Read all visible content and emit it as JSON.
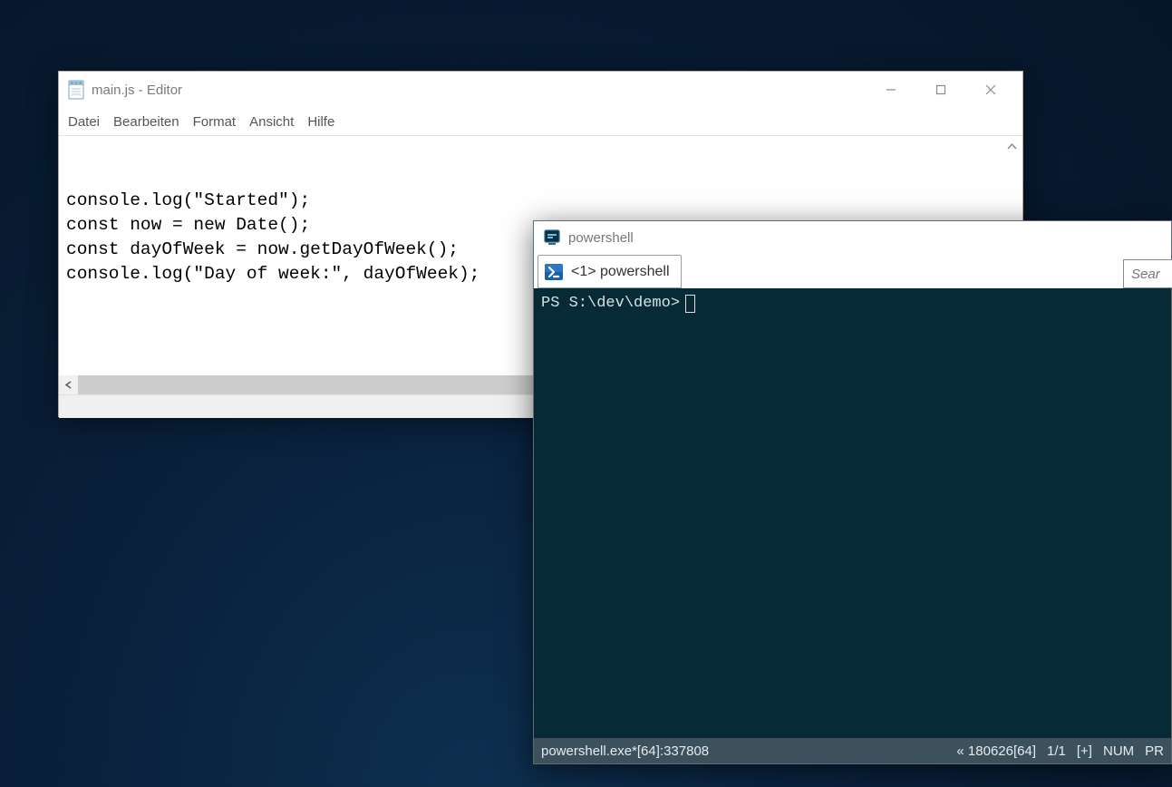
{
  "editor": {
    "title": "main.js - Editor",
    "menus": {
      "file": "Datei",
      "edit": "Bearbeiten",
      "format": "Format",
      "view": "Ansicht",
      "help": "Hilfe"
    },
    "content": "console.log(\"Started\");\nconst now = new Date();\nconst dayOfWeek = now.getDayOfWeek();\nconsole.log(\"Day of week:\", dayOfWeek);"
  },
  "powershell": {
    "title": "powershell",
    "tab_label": "<1> powershell",
    "search_placeholder": "Sear",
    "prompt": "PS S:\\dev\\demo>",
    "status": {
      "process": "powershell.exe*[64]:337808",
      "build": "« 180626[64]",
      "pane": "1/1",
      "expand": "[+]",
      "num": "NUM",
      "extra": "PR"
    }
  }
}
